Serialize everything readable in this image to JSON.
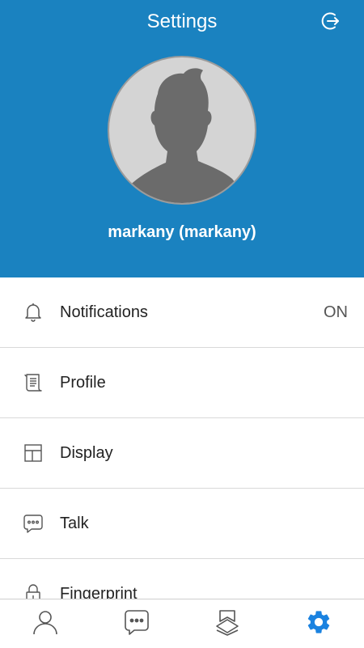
{
  "header": {
    "title": "Settings",
    "logout_icon": "logout-icon",
    "avatar_icon": "default-avatar",
    "user_name": "markany (markany)",
    "bg_color": "#1a82c0"
  },
  "menu": {
    "items": [
      {
        "label": "Notifications",
        "value": "ON",
        "icon": "bell-icon"
      },
      {
        "label": "Profile",
        "icon": "scroll-icon"
      },
      {
        "label": "Display",
        "icon": "layout-icon"
      },
      {
        "label": "Talk",
        "icon": "chat-bubble-icon"
      },
      {
        "label": "Fingerprint",
        "icon": "lock-icon"
      }
    ]
  },
  "bottom_nav": {
    "items": [
      {
        "icon": "person-icon",
        "active": false
      },
      {
        "icon": "chat-icon",
        "active": false
      },
      {
        "icon": "bookmark-chevron-icon",
        "active": false
      },
      {
        "icon": "gear-icon",
        "active": true
      }
    ],
    "active_color": "#1a82e0"
  }
}
